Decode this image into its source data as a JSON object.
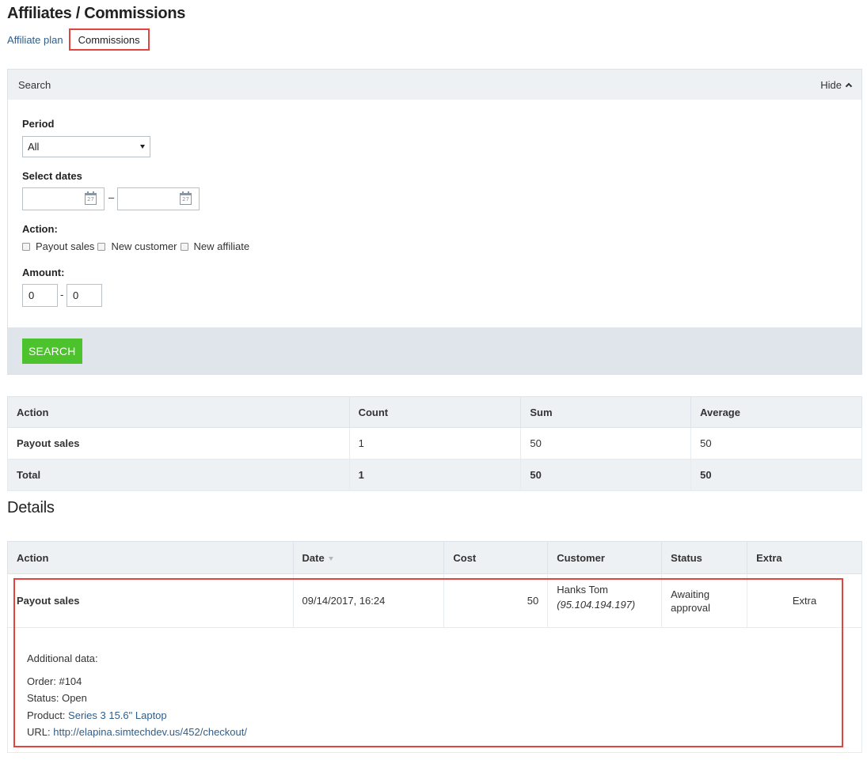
{
  "page": {
    "title": "Affiliates / Commissions"
  },
  "tabs": [
    {
      "label": "Affiliate plan"
    },
    {
      "label": "Commissions",
      "active": true
    }
  ],
  "search": {
    "title": "Search",
    "hide_label": "Hide",
    "period_label": "Period",
    "period_value": "All",
    "dates_label": "Select dates",
    "date_from": "",
    "date_to": "",
    "date_separator": "–",
    "calendar_day": "27",
    "action_label": "Action:",
    "actions": [
      "Payout sales",
      "New customer",
      "New affiliate"
    ],
    "amount_label": "Amount:",
    "amount_from": "0",
    "amount_to": "0",
    "amount_separator": "-",
    "button_label": "SEARCH"
  },
  "summary": {
    "headers": [
      "Action",
      "Count",
      "Sum",
      "Average"
    ],
    "rows": [
      {
        "action": "Payout sales",
        "count": "1",
        "sum": "50",
        "average": "50"
      }
    ],
    "total": {
      "label": "Total",
      "count": "1",
      "sum": "50",
      "average": "50"
    }
  },
  "details": {
    "title": "Details",
    "headers": [
      "Action",
      "Date",
      "Cost",
      "Customer",
      "Status",
      "Extra"
    ],
    "rows": [
      {
        "action": "Payout sales",
        "date": "09/14/2017, 16:24",
        "cost": "50",
        "customer_name": "Hanks Tom",
        "customer_ip": "(95.104.194.197)",
        "status": "Awaiting approval",
        "extra": "Extra",
        "additional": {
          "title": "Additional data:",
          "order_label": "Order:",
          "order_value": "#104",
          "status_label": "Status:",
          "status_value": "Open",
          "product_label": "Product:",
          "product_value": "Series 3 15.6\" Laptop",
          "url_label": "URL:",
          "url_value": "http://elapina.simtechdev.us/452/checkout/"
        }
      }
    ]
  },
  "colors": {
    "accent_green": "#4cc22d",
    "highlight_red": "#e2453f",
    "link_blue": "#2f5e8a",
    "panel_gray": "#eef1f4"
  }
}
